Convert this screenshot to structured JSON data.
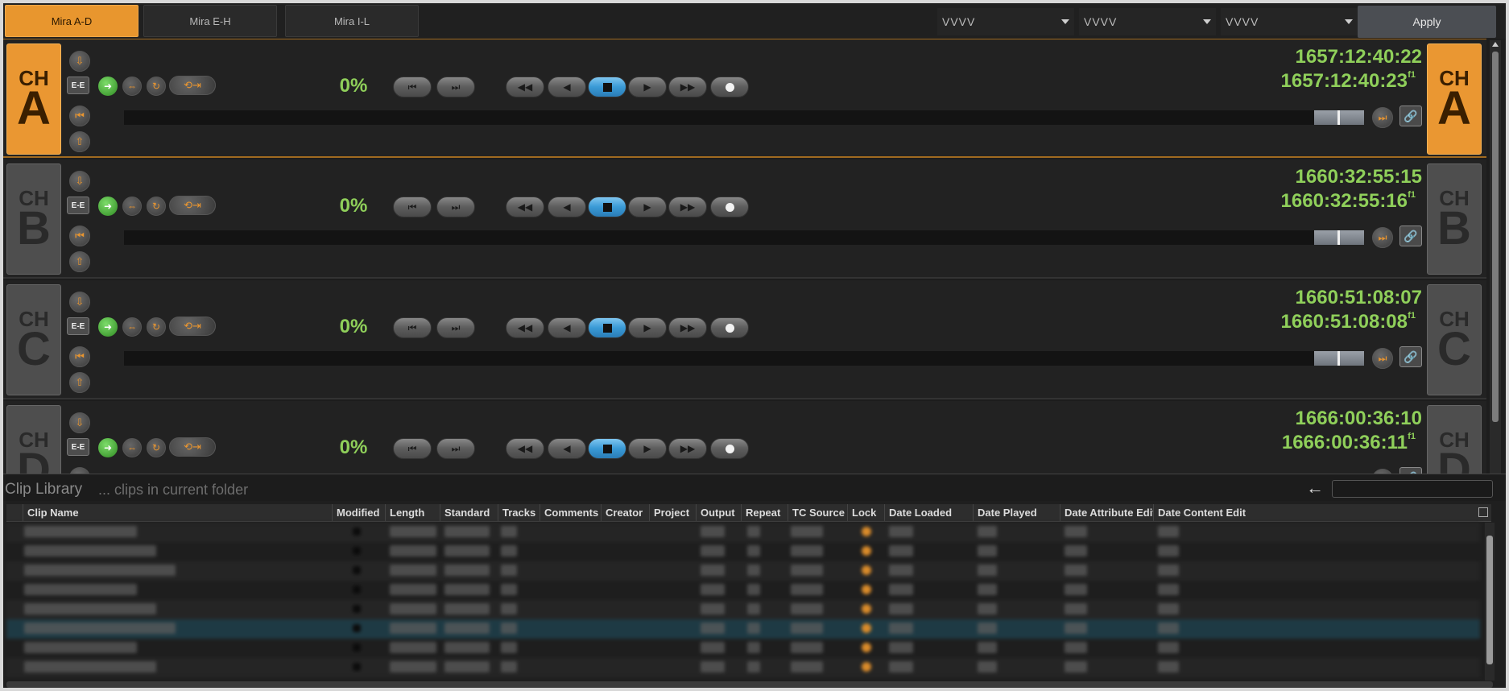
{
  "tabs": [
    "Mira A-D",
    "Mira E-H",
    "Mira I-L"
  ],
  "dropdowns": [
    "VVVV",
    "VVVV",
    "VVVV"
  ],
  "apply_label": "Apply",
  "channels": [
    {
      "ch": "CH",
      "letter": "A",
      "percent": "0%",
      "timecode": "1657:12:40:22",
      "timecode_field": "1657:12:40:23",
      "field_mark": "f1",
      "active": true
    },
    {
      "ch": "CH",
      "letter": "B",
      "percent": "0%",
      "timecode": "1660:32:55:15",
      "timecode_field": "1660:32:55:16",
      "field_mark": "f1",
      "active": false
    },
    {
      "ch": "CH",
      "letter": "C",
      "percent": "0%",
      "timecode": "1660:51:08:07",
      "timecode_field": "1660:51:08:08",
      "field_mark": "f1",
      "active": false
    },
    {
      "ch": "CH",
      "letter": "D",
      "percent": "0%",
      "timecode": "1666:00:36:10",
      "timecode_field": "1666:00:36:11",
      "field_mark": "f1",
      "active": false
    }
  ],
  "ee_label": "E-E",
  "library": {
    "title": "Clip Library",
    "subtitle": "... clips in current folder",
    "back_icon": "arrow-left-icon",
    "columns": [
      "Clip Name",
      "Modified",
      "Length",
      "Standard",
      "Tracks",
      "Comments",
      "Creator",
      "Project",
      "Output",
      "Repeat",
      "TC Source",
      "Lock",
      "Date Loaded",
      "Date Played",
      "Date Attribute Edit",
      "Date Content Edit"
    ],
    "row_count_visible": 8,
    "selected_row": 5
  },
  "colors": {
    "accent": "#e8962e",
    "timecode": "#8fcf5a",
    "stop": "#3a9ad6"
  }
}
